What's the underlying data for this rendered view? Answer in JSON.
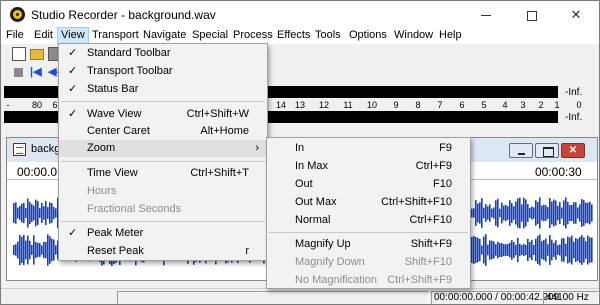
{
  "window": {
    "title": "Studio Recorder - background.wav",
    "min_icon": "minimize-icon",
    "max_icon": "maximize-icon",
    "close_symbol": "✕"
  },
  "menu": [
    "File",
    "Edit",
    "View",
    "Transport",
    "Navigate",
    "Special",
    "Process",
    "Effects",
    "Tools",
    "Options",
    "Window",
    "Help"
  ],
  "meter": {
    "scale": [
      "-",
      "80",
      "6",
      "14",
      "13",
      "12",
      "11",
      "10",
      "9",
      "8",
      "7",
      "6",
      "5",
      "4",
      "3",
      "2",
      "1",
      "0"
    ],
    "left_value": "-Inf.",
    "right_value": "-Inf."
  },
  "document": {
    "title": "backg",
    "close_symbol": "✕",
    "time_start": "00:00.0",
    "time_end": "00:00:30"
  },
  "view_menu": {
    "checkmark": "✓",
    "submenu_arrow": "›",
    "items": [
      {
        "label": "Standard Toolbar",
        "checked": true
      },
      {
        "label": "Transport Toolbar",
        "checked": true
      },
      {
        "label": "Status Bar",
        "checked": true
      },
      {
        "label": "Wave View",
        "shortcut": "Ctrl+Shift+W",
        "checked": true
      },
      {
        "label": "Center Caret",
        "shortcut": "Alt+Home"
      },
      {
        "label": "Zoom",
        "submenu": true
      },
      {
        "label": "Time View",
        "shortcut": "Ctrl+Shift+T"
      },
      {
        "label": "Hours",
        "disabled": true
      },
      {
        "label": "Fractional Seconds",
        "disabled": true
      },
      {
        "label": "Peak Meter",
        "checked": true
      },
      {
        "label": "Reset Peak",
        "shortcut": "r"
      }
    ]
  },
  "zoom_menu": {
    "items": [
      {
        "label": "In",
        "shortcut": "F9"
      },
      {
        "label": "In Max",
        "shortcut": "Ctrl+F9"
      },
      {
        "label": "Out",
        "shortcut": "F10"
      },
      {
        "label": "Out Max",
        "shortcut": "Ctrl+Shift+F10"
      },
      {
        "label": "Normal",
        "shortcut": "Ctrl+F10"
      },
      {
        "label": "Magnify Up",
        "shortcut": "Shift+F9"
      },
      {
        "label": "Magnify Down",
        "shortcut": "Shift+F10",
        "disabled": true
      },
      {
        "label": "No Magnification",
        "shortcut": "Ctrl+Shift+F9",
        "disabled": true
      }
    ]
  },
  "status": {
    "time": "00:00:00.000 / 00:00:42.209",
    "rate": "44100 Hz"
  },
  "colors": {
    "waveform": "#1e3fa6",
    "menu_highlight": "#cce8ff",
    "doc_close": "#c5453a"
  }
}
